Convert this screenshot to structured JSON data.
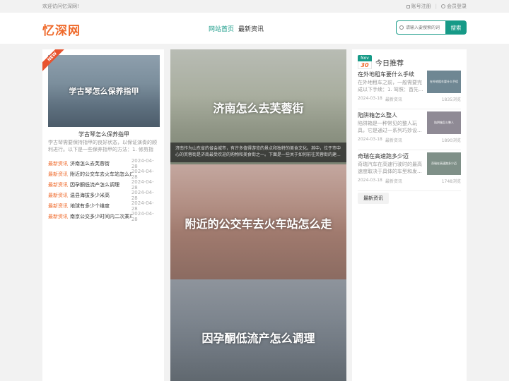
{
  "topbar": {
    "welcome": "欢迎访问忆深网!",
    "register": "账号注册",
    "login": "会员登录"
  },
  "header": {
    "logo": "忆深网",
    "nav": [
      {
        "label": "网站首页",
        "active": true
      },
      {
        "label": "最新资讯",
        "active": false
      }
    ],
    "search_placeholder": "请输入要搜索的词",
    "search_button": "搜索"
  },
  "left": {
    "badge": "NEW",
    "feature": {
      "image_text": "学古琴怎么保养指甲",
      "title": "学古琴怎么保养指甲",
      "desc": "学古琴需要保持指甲的良好状态，以保证演奏的顺利进行。以下是一些保养指甲的方法：1. 修剪指甲..."
    },
    "list": [
      {
        "cat": "最新资讯",
        "title": "济南怎么去芙蓉街",
        "date": "2024-04-28"
      },
      {
        "cat": "最新资讯",
        "title": "附近的公交车去火车站怎么走",
        "date": "2024-04-28"
      },
      {
        "cat": "最新资讯",
        "title": "因孕酮低流产怎么调理",
        "date": "2024-04-28"
      },
      {
        "cat": "最新资讯",
        "title": "温县海拔多少米高",
        "date": "2024-04-28"
      },
      {
        "cat": "最新资讯",
        "title": "地球有多少个维度",
        "date": "2024-04-28"
      },
      {
        "cat": "最新资讯",
        "title": "南京公交多少时间内二次乘车",
        "date": "2024-04-28"
      }
    ]
  },
  "center": {
    "slides": [
      {
        "title": "济南怎么去芙蓉街",
        "caption": "济南作为山东省的省会城市，有许多值得游览的景点和独特的美食文化。其中，位于市中心的芙蓉街是济南最受欢迎的购物和美食街之一。下面是一些关于如何前往芙蓉街的建..."
      },
      {
        "title": "附近的公交车去火车站怎么走"
      },
      {
        "title": "因孕酮低流产怎么调理"
      }
    ]
  },
  "right": {
    "date_month": "Nov",
    "date_day": "30",
    "title": "今日推荐",
    "items": [
      {
        "title": "在外地租车要什么手续",
        "desc": "在外地租车之前，一般需要完成以下手续：1. 驾照：首先...",
        "date": "2024-03-18",
        "cat": "最新资讯",
        "views": "1835浏览",
        "thumb_text": "在外地租车要什么手续",
        "thumb_color": "#6f8793"
      },
      {
        "title": "陷阱箱怎么整人",
        "desc": "陷阱箱是一种常见的整人玩具，它是通过一系列巧妙设...",
        "date": "2024-03-18",
        "cat": "最新资讯",
        "views": "1890浏览",
        "thumb_text": "陷阱箱怎么整人",
        "thumb_color": "#8f8a95"
      },
      {
        "title": "奇瑞在高速跑多少迈",
        "desc": "奇瑞汽车在高速行驶时的最高速度取决于具体的车型和发...",
        "date": "2024-03-18",
        "cat": "最新资讯",
        "views": "1748浏览",
        "thumb_text": "奇瑞在高速跑多少迈",
        "thumb_color": "#7f9088"
      }
    ],
    "tag": "最新资讯"
  }
}
